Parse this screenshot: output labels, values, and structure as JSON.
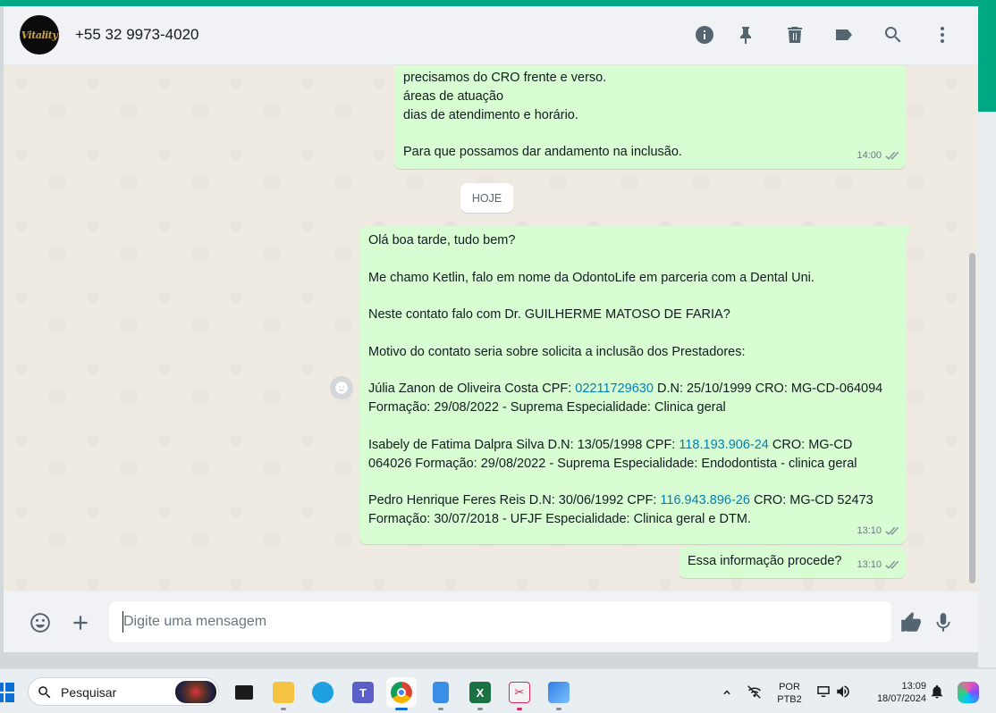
{
  "colors": {
    "accent": "#00a884",
    "outgoing_bubble": "#d9fdd3",
    "link": "#027eb5",
    "panel": "#f0f2f5"
  },
  "header": {
    "avatar_logo_text": "Vitality",
    "contact_name": "+55 32 9973-4020",
    "icons": [
      "info-icon",
      "pin-icon",
      "delete-icon",
      "label-icon",
      "search-icon",
      "menu-icon"
    ]
  },
  "chat": {
    "messages": [
      {
        "paragraphs": [
          "precisamos do CRO frente e verso.\náreas de atuação\ndias de atendimento e horário.",
          "Para que possamos dar andamento na inclusão."
        ],
        "time": "14:00"
      },
      {
        "paragraphs": [
          "Olá boa tarde, tudo bem?",
          "Me chamo Ketlin, falo em nome da OdontoLife em parceria com a Dental Uni.",
          "Neste contato falo com Dr. GUILHERME MATOSO DE FARIA?",
          "Motivo do contato seria sobre solicita a inclusão dos Prestadores:"
        ],
        "prestador1": {
          "before": "Júlia Zanon de Oliveira Costa CPF: ",
          "link": "02211729630",
          "after": " D.N: 25/10/1999 CRO: MG-CD-064094 Formação: 29/08/2022 - Suprema Especialidade: Clinica geral"
        },
        "prestador2": {
          "before": "Isabely de Fatima Dalpra Silva D.N: 13/05/1998 CPF: ",
          "link": "118.193.906-24",
          "after": " CRO: MG-CD 064026 Formação: 29/08/2022 - Suprema Especialidade: Endodontista - clinica geral"
        },
        "prestador3": {
          "before": "Pedro Henrique Feres Reis D.N: 30/06/1992 CPF: ",
          "link": "116.943.896-26",
          "after": " CRO: MG-CD 52473 Formação: 30/07/2018 - UFJF Especialidade: Clinica geral e DTM."
        },
        "time": "13:10"
      },
      {
        "text": "Essa informação procede?",
        "time": "13:10"
      }
    ],
    "day_chip": "HOJE"
  },
  "composer": {
    "placeholder": "Digite uma mensagem"
  },
  "taskbar": {
    "search_label": "Pesquisar",
    "language_line1": "POR",
    "language_line2": "PTB2",
    "time": "13:09",
    "date": "18/07/2024"
  }
}
